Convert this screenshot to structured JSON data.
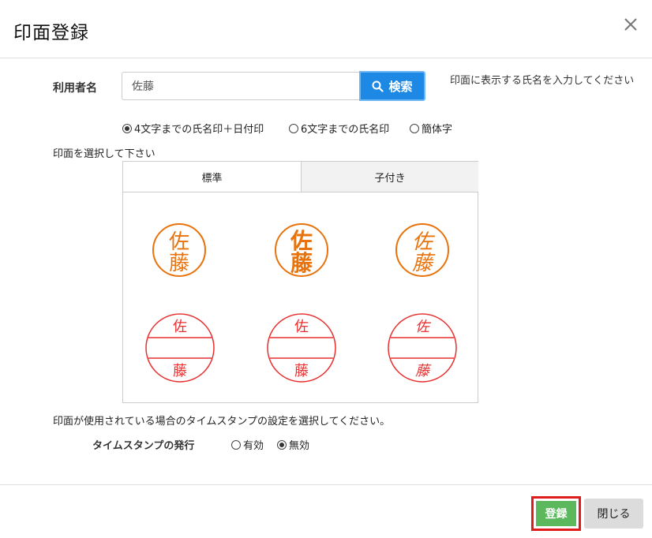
{
  "dialog": {
    "title": "印面登録"
  },
  "user": {
    "label": "利用者名",
    "input_value": "佐藤",
    "search_label": "検索",
    "hint": "印面に表示する氏名を入力してください"
  },
  "stamp_type": {
    "options": [
      {
        "label": "4文字までの氏名印＋日付印",
        "selected": true
      },
      {
        "label": "6文字までの氏名印",
        "selected": false
      },
      {
        "label": "簡体字",
        "selected": false
      }
    ]
  },
  "select_label": "印面を選択して下さい",
  "tabs": [
    {
      "label": "標準",
      "active": true
    },
    {
      "label": "子付き",
      "active": false
    }
  ],
  "stamps": {
    "name_top": "佐",
    "name_bottom": "藤",
    "name_color": "#e8730c",
    "date_color": "#e83030"
  },
  "timestamp": {
    "description": "印面が使用されている場合のタイムスタンプの設定を選択してください。",
    "label": "タイムスタンプの発行",
    "options": [
      {
        "label": "有効",
        "selected": false
      },
      {
        "label": "無効",
        "selected": true
      }
    ]
  },
  "footer": {
    "register_label": "登録",
    "close_label": "閉じる"
  }
}
